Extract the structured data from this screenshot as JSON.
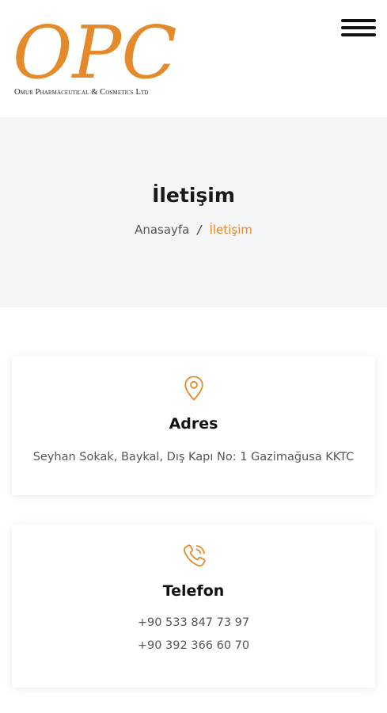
{
  "header": {
    "logo_text": "OPC",
    "logo_subtitle": "Omur Pharmaceutical & Cosmetics Ltd",
    "menu_icon": "hamburger-menu-icon"
  },
  "banner": {
    "title": "İletişim",
    "breadcrumb": {
      "home": "Anasayfa",
      "separator": "/",
      "current": "İletişim"
    }
  },
  "contact": {
    "address": {
      "icon": "location-pin-icon",
      "title": "Adres",
      "text": "Seyhan Sokak, Baykal, Dış Kapı No: 1 Gazimağusa KKTC"
    },
    "phone": {
      "icon": "phone-ringing-icon",
      "title": "Telefon",
      "numbers": [
        "+90 533 847 73 97",
        "+90 392 366 60 70"
      ]
    }
  },
  "colors": {
    "accent": "#e48a2a",
    "banner_bg": "#f4f5f7",
    "text": "#222222",
    "muted": "#555555"
  }
}
